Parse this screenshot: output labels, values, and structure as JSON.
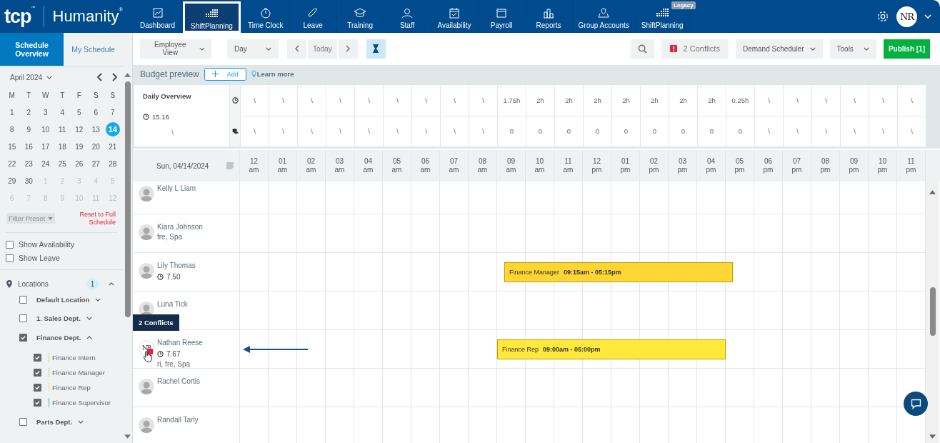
{
  "nav": {
    "brand": "tcp$^{™}$",
    "product": "Humanity$^{®}$",
    "items": [
      {
        "label": "Dashboard",
        "selected": false
      },
      {
        "label": "ShiftPlanning",
        "selected": true
      },
      {
        "label": "Time Clock",
        "selected": false
      },
      {
        "label": "Leave",
        "selected": false
      },
      {
        "label": "Training",
        "selected": false
      },
      {
        "label": "Staff",
        "selected": false
      },
      {
        "label": "Availability",
        "selected": false
      },
      {
        "label": "Payroll",
        "selected": false
      },
      {
        "label": "Reports",
        "selected": false
      },
      {
        "label": "Group Accounts",
        "selected": false
      },
      {
        "label": "ShiftPlanning",
        "selected": false,
        "badge": "Legacy"
      }
    ],
    "user_initials": "NR"
  },
  "sidebar": {
    "tabs": [
      {
        "label": "Schedule Overview",
        "selected": true
      },
      {
        "label": "My Schedule",
        "selected": false
      }
    ],
    "calendar": {
      "month": "April 2024",
      "weekdays": [
        "M",
        "T",
        "W",
        "T",
        "F",
        "S",
        "S"
      ],
      "weeks": [
        [
          {
            "d": "1",
            "muted": false,
            "selected": false
          },
          {
            "d": "2",
            "muted": false,
            "selected": false
          },
          {
            "d": "3",
            "muted": false,
            "selected": false
          },
          {
            "d": "4",
            "muted": false,
            "selected": false
          },
          {
            "d": "5",
            "muted": false,
            "selected": false
          },
          {
            "d": "6",
            "muted": false,
            "selected": false
          },
          {
            "d": "7",
            "muted": false,
            "selected": false
          }
        ],
        [
          {
            "d": "8",
            "muted": false,
            "selected": false
          },
          {
            "d": "9",
            "muted": false,
            "selected": false
          },
          {
            "d": "10",
            "muted": false,
            "selected": false
          },
          {
            "d": "11",
            "muted": false,
            "selected": false
          },
          {
            "d": "12",
            "muted": false,
            "selected": false
          },
          {
            "d": "13",
            "muted": false,
            "selected": false
          },
          {
            "d": "14",
            "muted": false,
            "selected": true
          }
        ],
        [
          {
            "d": "15",
            "muted": false,
            "selected": false
          },
          {
            "d": "16",
            "muted": false,
            "selected": false
          },
          {
            "d": "17",
            "muted": false,
            "selected": false
          },
          {
            "d": "18",
            "muted": false,
            "selected": false
          },
          {
            "d": "19",
            "muted": false,
            "selected": false
          },
          {
            "d": "20",
            "muted": false,
            "selected": false
          },
          {
            "d": "21",
            "muted": false,
            "selected": false
          }
        ],
        [
          {
            "d": "22",
            "muted": false,
            "selected": false
          },
          {
            "d": "23",
            "muted": false,
            "selected": false
          },
          {
            "d": "24",
            "muted": false,
            "selected": false
          },
          {
            "d": "25",
            "muted": false,
            "selected": false
          },
          {
            "d": "26",
            "muted": false,
            "selected": false
          },
          {
            "d": "27",
            "muted": false,
            "selected": false
          },
          {
            "d": "28",
            "muted": false,
            "selected": false
          }
        ],
        [
          {
            "d": "29",
            "muted": false,
            "selected": false
          },
          {
            "d": "30",
            "muted": false,
            "selected": false
          },
          {
            "d": "1",
            "muted": true,
            "selected": false
          },
          {
            "d": "2",
            "muted": true,
            "selected": false
          },
          {
            "d": "3",
            "muted": true,
            "selected": false
          },
          {
            "d": "4",
            "muted": true,
            "selected": false
          },
          {
            "d": "5",
            "muted": true,
            "selected": false
          }
        ],
        [
          {
            "d": "6",
            "muted": true,
            "selected": false
          },
          {
            "d": "7",
            "muted": true,
            "selected": false
          },
          {
            "d": "8",
            "muted": true,
            "selected": false
          },
          {
            "d": "9",
            "muted": true,
            "selected": false
          },
          {
            "d": "10",
            "muted": true,
            "selected": false
          },
          {
            "d": "11",
            "muted": true,
            "selected": false
          },
          {
            "d": "12",
            "muted": true,
            "selected": false
          }
        ]
      ]
    },
    "filter_preset": "Filter Preset",
    "reset_link": "Reset to Full Schedule",
    "toggles": [
      {
        "label": "Show Availability",
        "checked": false
      },
      {
        "label": "Show Leave",
        "checked": false
      }
    ],
    "locations": {
      "label": "Locations",
      "count": "1",
      "expanded": true,
      "items": [
        {
          "label": "Default Location",
          "checked": false,
          "expanded": false
        },
        {
          "label": "1. Sales Dept.",
          "checked": false,
          "expanded": false
        },
        {
          "label": "Finance Dept.",
          "checked": true,
          "expanded": true,
          "children": [
            {
              "label": "Finance Intern",
              "checked": true,
              "color": "#f2d64b"
            },
            {
              "label": "Finance Manager",
              "checked": true,
              "color": "#f2c94b"
            },
            {
              "label": "Finance Rep",
              "checked": true,
              "color": "#f5e04b"
            },
            {
              "label": "Finance Supervisor",
              "checked": true,
              "color": "#2ec4a6"
            }
          ]
        },
        {
          "label": "Parts Dept.",
          "checked": false,
          "expanded": false
        }
      ]
    }
  },
  "toolbar": {
    "view": "Employee View",
    "range": "Day",
    "today": "Today",
    "timer_on": true,
    "conflicts": "2 Conflicts",
    "demand": "Demand Scheduler",
    "tools": "Tools",
    "publish": "Publish [1]"
  },
  "budget": {
    "title": "Budget preview",
    "add": "Add",
    "learn_more": "Learn more",
    "overview": {
      "title": "Daily Overview",
      "hours": "15.16",
      "cost": "\\"
    },
    "hours_row": [
      "\\",
      "\\",
      "\\",
      "\\",
      "\\",
      "\\",
      "\\",
      "\\",
      "\\",
      "1.75h",
      "2h",
      "2h",
      "2h",
      "2h",
      "2h",
      "2h",
      "2h",
      "0.25h",
      "\\",
      "\\",
      "\\",
      "\\",
      "\\",
      "\\"
    ],
    "cost_row": [
      "\\",
      "\\",
      "\\",
      "\\",
      "\\",
      "\\",
      "\\",
      "\\",
      "\\",
      "0",
      "0",
      "0",
      "0",
      "0",
      "0",
      "0",
      "0",
      "0",
      "\\",
      "\\",
      "\\",
      "\\",
      "\\",
      "\\"
    ]
  },
  "schedule": {
    "date": "Sun, 04/14/2024",
    "hours": [
      "12 am",
      "01 am",
      "02 am",
      "03 am",
      "04 am",
      "05 am",
      "06 am",
      "07 am",
      "08 am",
      "09 am",
      "10 am",
      "11 am",
      "12 pm",
      "01 pm",
      "02 pm",
      "03 pm",
      "04 pm",
      "05 pm",
      "06 pm",
      "07 pm",
      "08 pm",
      "09 pm",
      "10 pm",
      "11 pm"
    ],
    "employees": [
      {
        "name": "Kelly L Liam"
      },
      {
        "name": "Kiara Johnson",
        "skills": "fre, Spa"
      },
      {
        "name": "Lily Thomas",
        "hours": "7.50",
        "shifts": [
          {
            "title": "Finance Manager",
            "time": "09:15am - 05:15pm",
            "color": "#ffd633"
          }
        ]
      },
      {
        "name": "Luna Tick"
      },
      {
        "name": "Nathan Reese",
        "initials": "NR",
        "conflict": true,
        "tooltip": "2 Conflicts",
        "hours": "7.67",
        "skills": "ri, fre, Spa",
        "shifts": [
          {
            "title": "Finance Rep",
            "time": "09:00am - 05:00pm",
            "color": "#ffe93b"
          }
        ]
      },
      {
        "name": "Rachel Cortis"
      },
      {
        "name": "Randall Tarly"
      }
    ]
  }
}
